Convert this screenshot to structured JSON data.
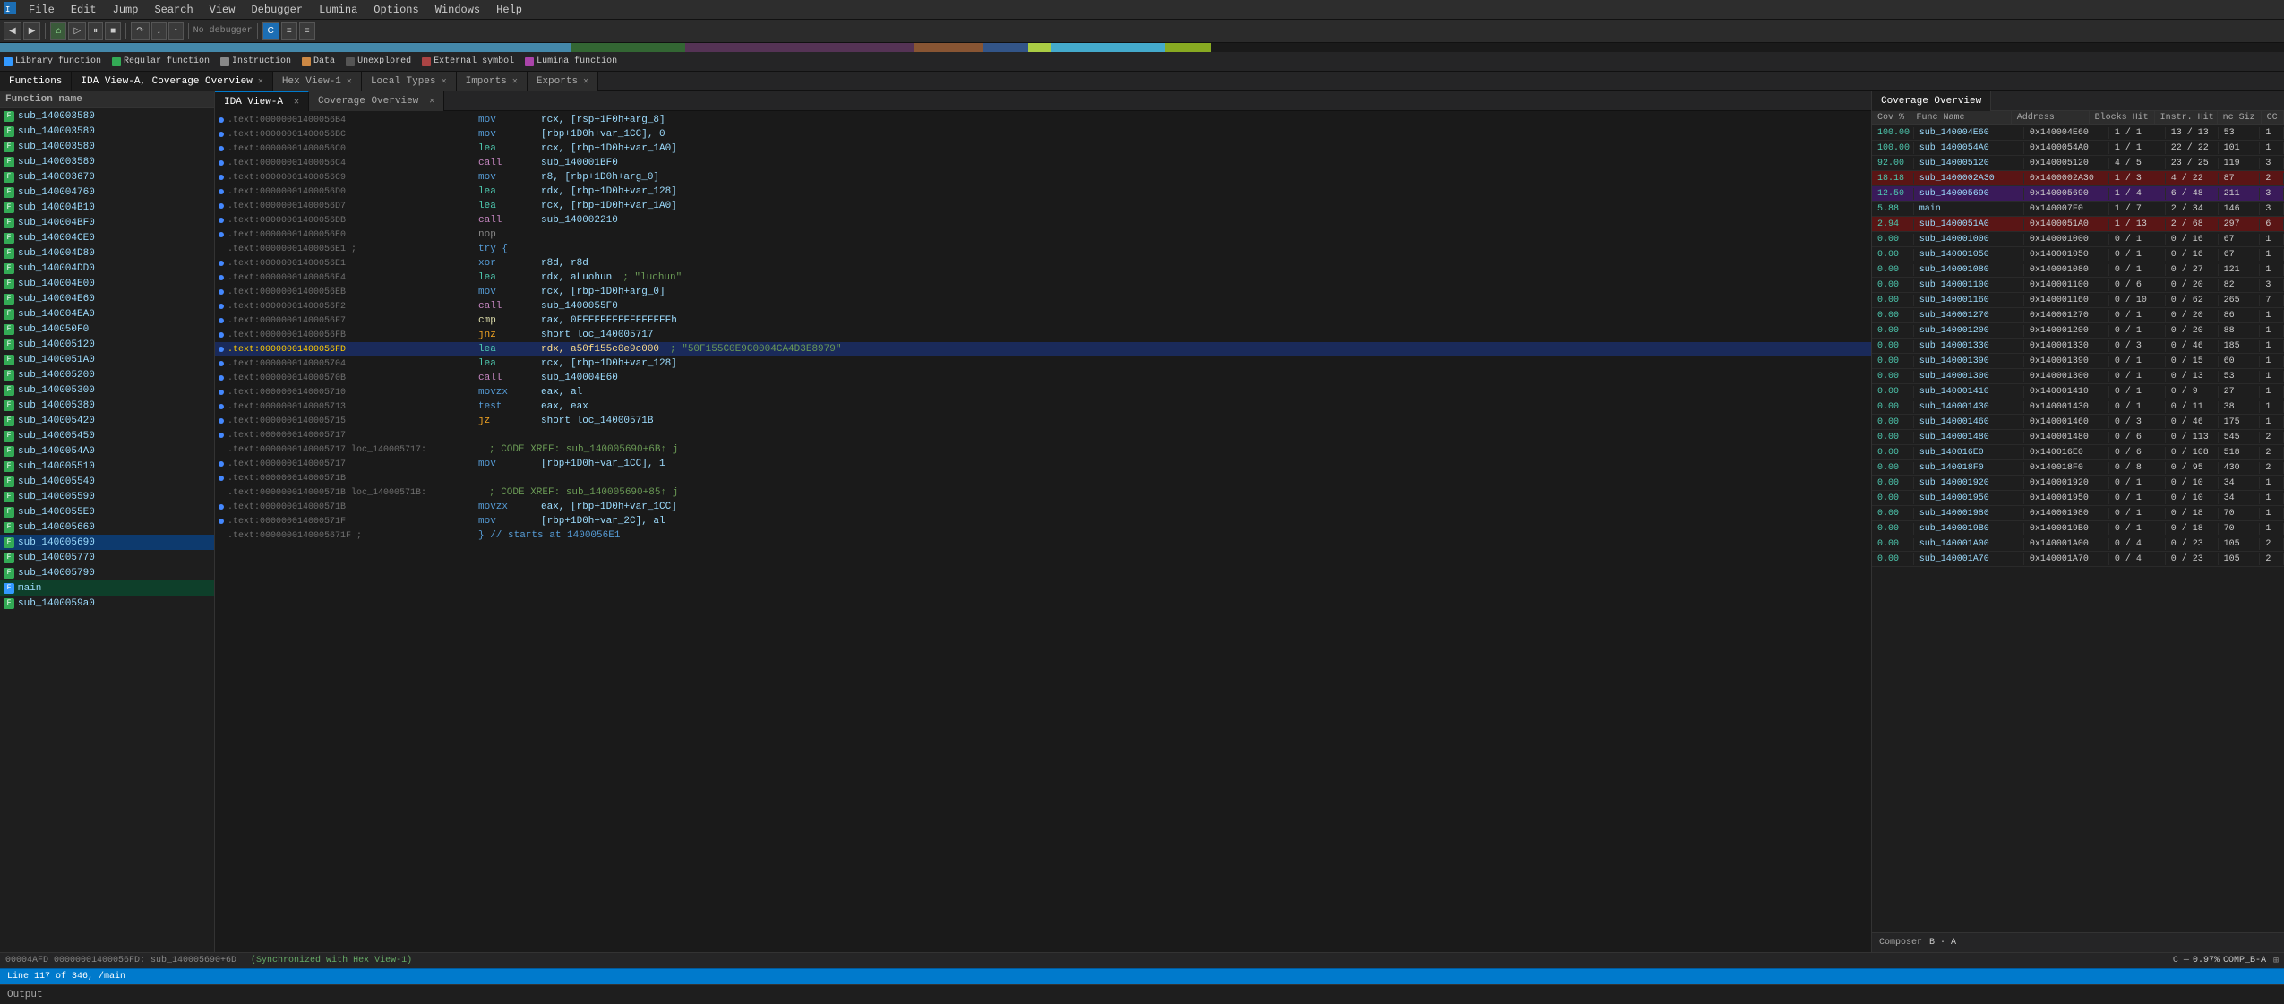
{
  "menubar": {
    "items": [
      "File",
      "Edit",
      "Jump",
      "Search",
      "View",
      "Debugger",
      "Lumina",
      "Options",
      "Windows",
      "Help"
    ]
  },
  "toolbar": {
    "debugger_label": "No debugger"
  },
  "functions_panel": {
    "title": "Functions",
    "header": "Function name",
    "items": [
      {
        "name": "sub_140003580",
        "type": "regular"
      },
      {
        "name": "sub_140003580",
        "type": "regular"
      },
      {
        "name": "sub_140003580",
        "type": "regular"
      },
      {
        "name": "sub_140003580",
        "type": "regular"
      },
      {
        "name": "sub_140003670",
        "type": "regular"
      },
      {
        "name": "sub_140004760",
        "type": "regular"
      },
      {
        "name": "sub_140004B10",
        "type": "regular"
      },
      {
        "name": "sub_140004BF0",
        "type": "regular"
      },
      {
        "name": "sub_140004CE0",
        "type": "regular"
      },
      {
        "name": "sub_140004D80",
        "type": "regular"
      },
      {
        "name": "sub_140004DD0",
        "type": "regular"
      },
      {
        "name": "sub_140004E00",
        "type": "regular"
      },
      {
        "name": "sub_140004E60",
        "type": "regular"
      },
      {
        "name": "sub_140004EA0",
        "type": "regular"
      },
      {
        "name": "sub_140050F0",
        "type": "regular"
      },
      {
        "name": "sub_140005120",
        "type": "regular"
      },
      {
        "name": "sub_1400051A0",
        "type": "regular"
      },
      {
        "name": "sub_140005200",
        "type": "regular"
      },
      {
        "name": "sub_140005300",
        "type": "regular"
      },
      {
        "name": "sub_140005380",
        "type": "regular"
      },
      {
        "name": "sub_140005420",
        "type": "regular"
      },
      {
        "name": "sub_140005450",
        "type": "regular"
      },
      {
        "name": "sub_1400054A0",
        "type": "regular"
      },
      {
        "name": "sub_140005510",
        "type": "regular"
      },
      {
        "name": "sub_140005540",
        "type": "regular"
      },
      {
        "name": "sub_140005590",
        "type": "regular"
      },
      {
        "name": "sub_1400055E0",
        "type": "regular"
      },
      {
        "name": "sub_140005660",
        "type": "regular"
      },
      {
        "name": "sub_140005690",
        "type": "regular"
      },
      {
        "name": "sub_140005770",
        "type": "regular"
      },
      {
        "name": "sub_140005790",
        "type": "regular"
      },
      {
        "name": "main",
        "type": "main"
      },
      {
        "name": "sub_1400059a0",
        "type": "regular"
      }
    ]
  },
  "tabs": {
    "ida_view_coverage": "IDA View-A, Coverage Overview",
    "hex_view": "Hex View-1",
    "local_types": "Local Types",
    "imports": "Imports",
    "exports": "Exports",
    "ida_view_a": "IDA View-A",
    "coverage_overview": "Coverage Overview"
  },
  "code_lines": [
    {
      "addr": ".text:00000001400056B4",
      "mnem": "mov",
      "mnem_class": "",
      "operands": "rcx, [rsp+1F0h+arg_8]",
      "comment": ""
    },
    {
      "addr": ".text:00000001400056BC",
      "mnem": "mov",
      "mnem_class": "",
      "operands": "[rbp+1D0h+var_1CC], 0",
      "comment": ""
    },
    {
      "addr": ".text:00000001400056C0",
      "mnem": "lea",
      "mnem_class": "lea",
      "operands": "rcx, [rbp+1D0h+var_1A0]",
      "comment": ""
    },
    {
      "addr": ".text:00000001400056C4",
      "mnem": "call",
      "mnem_class": "call",
      "operands": "sub_140001BF0",
      "comment": ""
    },
    {
      "addr": ".text:00000001400056C9",
      "mnem": "mov",
      "mnem_class": "",
      "operands": "r8, [rbp+1D0h+arg_0]",
      "comment": ""
    },
    {
      "addr": ".text:00000001400056D0",
      "mnem": "lea",
      "mnem_class": "lea",
      "operands": "rdx, [rbp+1D0h+var_128]",
      "comment": ""
    },
    {
      "addr": ".text:00000001400056D7",
      "mnem": "lea",
      "mnem_class": "lea",
      "operands": "rcx, [rbp+1D0h+var_1A0]",
      "comment": ""
    },
    {
      "addr": ".text:00000001400056DB",
      "mnem": "call",
      "mnem_class": "call",
      "operands": "sub_140002210",
      "comment": ""
    },
    {
      "addr": ".text:00000001400056E0",
      "mnem": "nop",
      "mnem_class": "",
      "operands": "",
      "comment": ""
    },
    {
      "addr": ".text:00000001400056E1 ;",
      "mnem": "",
      "mnem_class": "",
      "operands": "try {",
      "comment": "",
      "special": "try"
    },
    {
      "addr": ".text:00000001400056E1",
      "mnem": "xor",
      "mnem_class": "",
      "operands": "r8d, r8d",
      "comment": ""
    },
    {
      "addr": ".text:00000001400056E4",
      "mnem": "lea",
      "mnem_class": "lea",
      "operands": "rdx, aLuohun",
      "comment": "; \"luohun\""
    },
    {
      "addr": ".text:00000001400056EB",
      "mnem": "mov",
      "mnem_class": "",
      "operands": "rcx, [rbp+1D0h+arg_0]",
      "comment": ""
    },
    {
      "addr": ".text:00000001400056F2",
      "mnem": "call",
      "mnem_class": "call",
      "operands": "sub_1400055F0",
      "comment": ""
    },
    {
      "addr": ".text:00000001400056F7",
      "mnem": "cmp",
      "mnem_class": "cmp",
      "operands": "rax, 0FFFFFFFFFFFFFFFFh",
      "comment": ""
    },
    {
      "addr": ".text:00000001400056FB",
      "mnem": "jnz",
      "mnem_class": "jmp",
      "operands": "short loc_140005717",
      "comment": ""
    },
    {
      "addr": ".text:00000001400056FD",
      "mnem": "lea",
      "mnem_class": "lea",
      "operands": "rdx, a50f155c0e9c000",
      "comment": "; \"50F155C0E9C0004CA4D3E8979\"",
      "highlight": true
    },
    {
      "addr": ".text:0000000140005704",
      "mnem": "lea",
      "mnem_class": "lea",
      "operands": "rcx, [rbp+1D0h+var_128]",
      "comment": ""
    },
    {
      "addr": ".text:000000014000570B",
      "mnem": "call",
      "mnem_class": "call",
      "operands": "sub_140004E60",
      "comment": ""
    },
    {
      "addr": ".text:0000000140005710",
      "mnem": "movzx",
      "mnem_class": "",
      "operands": "eax, al",
      "comment": ""
    },
    {
      "addr": ".text:0000000140005713",
      "mnem": "test",
      "mnem_class": "",
      "operands": "eax, eax",
      "comment": ""
    },
    {
      "addr": ".text:0000000140005715",
      "mnem": "jz",
      "mnem_class": "jmp",
      "operands": "short loc_14000571B",
      "comment": ""
    },
    {
      "addr": ".text:0000000140005717",
      "mnem": "",
      "mnem_class": "",
      "operands": "",
      "comment": ""
    },
    {
      "addr": ".text:0000000140005717 loc_140005717:",
      "mnem": "",
      "mnem_class": "",
      "operands": "",
      "comment": "; CODE XREF: sub_140005690+6B↑ j",
      "special": "loc"
    },
    {
      "addr": ".text:0000000140005717",
      "mnem": "mov",
      "mnem_class": "",
      "operands": "[rbp+1D0h+var_1CC], 1",
      "comment": ""
    },
    {
      "addr": ".text:000000014000571B",
      "mnem": "",
      "mnem_class": "",
      "operands": "",
      "comment": ""
    },
    {
      "addr": ".text:000000014000571B loc_14000571B:",
      "mnem": "",
      "mnem_class": "",
      "operands": "",
      "comment": "; CODE XREF: sub_140005690+85↑ j",
      "special": "loc"
    },
    {
      "addr": ".text:000000014000571B",
      "mnem": "movzx",
      "mnem_class": "",
      "operands": "eax, [rbp+1D0h+var_1CC]",
      "comment": ""
    },
    {
      "addr": ".text:000000014000571F",
      "mnem": "mov",
      "mnem_class": "",
      "operands": "[rbp+1D0h+var_2C], al",
      "comment": ""
    },
    {
      "addr": ".text:0000000140005671F ;",
      "mnem": "",
      "mnem_class": "",
      "operands": "} // starts at 1400056E1",
      "comment": "",
      "special": "end"
    }
  ],
  "coverage": {
    "title": "Coverage Overview",
    "columns": [
      "Cov %",
      "Func Name",
      "Address",
      "Blocks Hit",
      "Instr. Hit",
      "nc Siz",
      "CC"
    ],
    "rows": [
      {
        "cov": "100.00",
        "name": "sub_140004E60",
        "addr": "0x140004E60",
        "blocks": "1 / 1",
        "instr": "13 / 13",
        "size": "53",
        "cc": "1",
        "style": ""
      },
      {
        "cov": "100.00",
        "name": "sub_1400054A0",
        "addr": "0x1400054A0",
        "blocks": "1 / 1",
        "instr": "22 / 22",
        "size": "101",
        "cc": "1",
        "style": ""
      },
      {
        "cov": "92.00",
        "name": "sub_140005120",
        "addr": "0x140005120",
        "blocks": "4 / 5",
        "instr": "23 / 25",
        "size": "119",
        "cc": "3",
        "style": ""
      },
      {
        "cov": "18.18",
        "name": "sub_1400002A30",
        "addr": "0x1400002A30",
        "blocks": "1 / 3",
        "instr": "4 / 22",
        "size": "87",
        "cc": "2",
        "style": "red"
      },
      {
        "cov": "12.50",
        "name": "sub_140005690",
        "addr": "0x140005690",
        "blocks": "1 / 4",
        "instr": "6 / 48",
        "size": "211",
        "cc": "3",
        "style": "purple"
      },
      {
        "cov": "5.88",
        "name": "main",
        "addr": "0x140007F0",
        "blocks": "1 / 7",
        "instr": "2 / 34",
        "size": "146",
        "cc": "3",
        "style": ""
      },
      {
        "cov": "2.94",
        "name": "sub_1400051A0",
        "addr": "0x1400051A0",
        "blocks": "1 / 13",
        "instr": "2 / 68",
        "size": "297",
        "cc": "6",
        "style": "red"
      },
      {
        "cov": "0.00",
        "name": "sub_140001000",
        "addr": "0x140001000",
        "blocks": "0 / 1",
        "instr": "0 / 16",
        "size": "67",
        "cc": "1",
        "style": ""
      },
      {
        "cov": "0.00",
        "name": "sub_140001050",
        "addr": "0x140001050",
        "blocks": "0 / 1",
        "instr": "0 / 16",
        "size": "67",
        "cc": "1",
        "style": ""
      },
      {
        "cov": "0.00",
        "name": "sub_140001080",
        "addr": "0x140001080",
        "blocks": "0 / 1",
        "instr": "0 / 27",
        "size": "121",
        "cc": "1",
        "style": ""
      },
      {
        "cov": "0.00",
        "name": "sub_140001100",
        "addr": "0x140001100",
        "blocks": "0 / 6",
        "instr": "0 / 20",
        "size": "82",
        "cc": "3",
        "style": ""
      },
      {
        "cov": "0.00",
        "name": "sub_140001160",
        "addr": "0x140001160",
        "blocks": "0 / 10",
        "instr": "0 / 62",
        "size": "265",
        "cc": "7",
        "style": ""
      },
      {
        "cov": "0.00",
        "name": "sub_140001270",
        "addr": "0x140001270",
        "blocks": "0 / 1",
        "instr": "0 / 20",
        "size": "86",
        "cc": "1",
        "style": ""
      },
      {
        "cov": "0.00",
        "name": "sub_140001200",
        "addr": "0x140001200",
        "blocks": "0 / 1",
        "instr": "0 / 20",
        "size": "88",
        "cc": "1",
        "style": ""
      },
      {
        "cov": "0.00",
        "name": "sub_140001330",
        "addr": "0x140001330",
        "blocks": "0 / 3",
        "instr": "0 / 46",
        "size": "185",
        "cc": "1",
        "style": ""
      },
      {
        "cov": "0.00",
        "name": "sub_140001390",
        "addr": "0x140001390",
        "blocks": "0 / 1",
        "instr": "0 / 15",
        "size": "60",
        "cc": "1",
        "style": ""
      },
      {
        "cov": "0.00",
        "name": "sub_140001300",
        "addr": "0x140001300",
        "blocks": "0 / 1",
        "instr": "0 / 13",
        "size": "53",
        "cc": "1",
        "style": ""
      },
      {
        "cov": "0.00",
        "name": "sub_140001410",
        "addr": "0x140001410",
        "blocks": "0 / 1",
        "instr": "0 / 9",
        "size": "27",
        "cc": "1",
        "style": ""
      },
      {
        "cov": "0.00",
        "name": "sub_140001430",
        "addr": "0x140001430",
        "blocks": "0 / 1",
        "instr": "0 / 11",
        "size": "38",
        "cc": "1",
        "style": ""
      },
      {
        "cov": "0.00",
        "name": "sub_140001460",
        "addr": "0x140001460",
        "blocks": "0 / 3",
        "instr": "0 / 46",
        "size": "175",
        "cc": "1",
        "style": ""
      },
      {
        "cov": "0.00",
        "name": "sub_140001480",
        "addr": "0x140001480",
        "blocks": "0 / 6",
        "instr": "0 / 113",
        "size": "545",
        "cc": "2",
        "style": ""
      },
      {
        "cov": "0.00",
        "name": "sub_140016E0",
        "addr": "0x140016E0",
        "blocks": "0 / 6",
        "instr": "0 / 108",
        "size": "518",
        "cc": "2",
        "style": ""
      },
      {
        "cov": "0.00",
        "name": "sub_140018F0",
        "addr": "0x140018F0",
        "blocks": "0 / 8",
        "instr": "0 / 95",
        "size": "430",
        "cc": "2",
        "style": ""
      },
      {
        "cov": "0.00",
        "name": "sub_140001920",
        "addr": "0x140001920",
        "blocks": "0 / 1",
        "instr": "0 / 10",
        "size": "34",
        "cc": "1",
        "style": ""
      },
      {
        "cov": "0.00",
        "name": "sub_140001950",
        "addr": "0x140001950",
        "blocks": "0 / 1",
        "instr": "0 / 10",
        "size": "34",
        "cc": "1",
        "style": ""
      },
      {
        "cov": "0.00",
        "name": "sub_140001980",
        "addr": "0x140001980",
        "blocks": "0 / 1",
        "instr": "0 / 18",
        "size": "70",
        "cc": "1",
        "style": ""
      },
      {
        "cov": "0.00",
        "name": "sub_1400019B0",
        "addr": "0x1400019B0",
        "blocks": "0 / 1",
        "instr": "0 / 18",
        "size": "70",
        "cc": "1",
        "style": ""
      },
      {
        "cov": "0.00",
        "name": "sub_140001A00",
        "addr": "0x140001A00",
        "blocks": "0 / 4",
        "instr": "0 / 23",
        "size": "105",
        "cc": "2",
        "style": ""
      },
      {
        "cov": "0.00",
        "name": "sub_140001A70",
        "addr": "0x140001A70",
        "blocks": "0 / 4",
        "instr": "0 / 23",
        "size": "105",
        "cc": "2",
        "style": ""
      }
    ]
  },
  "status_bar": {
    "line_info": "Line 117 of 346, /main",
    "hex_info": "00004AFD  00000001400056FD: sub_140005690+6D",
    "hex_sync": "(Synchronized with Hex View-1)",
    "composer": "B · A",
    "lang": "C",
    "coverage_pct": "0.97%",
    "comp": "COMP_B-A"
  },
  "output_bar": {
    "label": "Output"
  },
  "legend": {
    "library_function": "Library function",
    "regular_function": "Regular function",
    "instruction": "Instruction",
    "data": "Data",
    "unexplored": "Unexplored",
    "external_symbol": "External symbol",
    "lumina_function": "Lumina function"
  }
}
